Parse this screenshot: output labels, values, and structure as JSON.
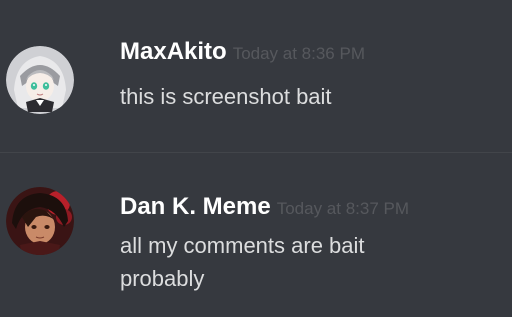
{
  "colors": {
    "background": "#36393f",
    "username": "#ffffff",
    "timestamp": "#56585d",
    "message_text": "#dcddde",
    "divider": "#42454a"
  },
  "messages": [
    {
      "username": "MaxAkito",
      "timestamp": "Today at 8:36 PM",
      "lines": [
        "this is screenshot bait"
      ],
      "avatar_icon": "anime-girl-avatar-icon"
    },
    {
      "username": "Dan K. Meme",
      "timestamp": "Today at 8:37 PM",
      "lines": [
        "all my comments are bait",
        "probably"
      ],
      "avatar_icon": "anime-boy-avatar-icon"
    }
  ]
}
